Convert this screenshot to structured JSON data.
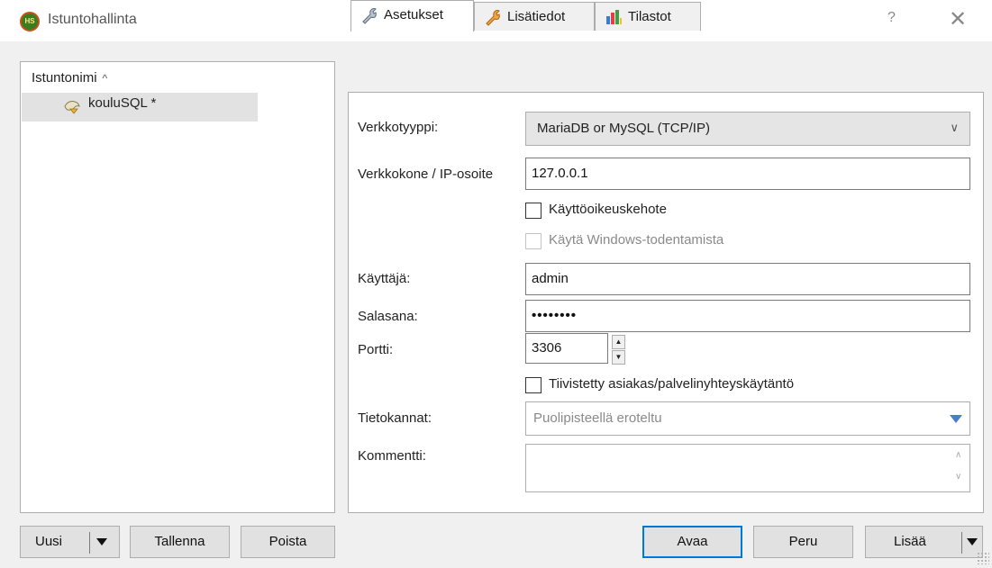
{
  "window": {
    "title": "Istuntohallinta",
    "icon_text": "HS",
    "help_label": "?",
    "close_label": "✕"
  },
  "session_list": {
    "header": "Istuntonimi",
    "sort_indicator": "^",
    "items": [
      {
        "label": "kouluSQL *",
        "icon": "dolphin-session-icon",
        "selected": true
      }
    ]
  },
  "tabs": [
    {
      "label": "Asetukset",
      "icon": "wrench-icon",
      "active": true
    },
    {
      "label": "Lisätiedot",
      "icon": "wrench-orange-icon",
      "active": false
    },
    {
      "label": "Tilastot",
      "icon": "bar-chart-icon",
      "active": false
    }
  ],
  "settings": {
    "network_type": {
      "label": "Verkkotyyppi:",
      "value": "MariaDB or MySQL (TCP/IP)"
    },
    "host": {
      "label": "Verkkokone / IP-osoite",
      "value": "127.0.0.1"
    },
    "prompt_credentials": {
      "label": "Käyttöoikeuskehote",
      "checked": false
    },
    "windows_auth": {
      "label": "Käytä Windows-todentamista",
      "checked": false,
      "disabled": true
    },
    "user": {
      "label": "Käyttäjä:",
      "value": "admin"
    },
    "password": {
      "label": "Salasana:",
      "value": "••••••••"
    },
    "port": {
      "label": "Portti:",
      "value": "3306"
    },
    "compressed": {
      "label": "Tiivistetty asiakas/palvelinyhteyskäytäntö",
      "checked": false
    },
    "databases": {
      "label": "Tietokannat:",
      "placeholder": "Puolipisteellä eroteltu"
    },
    "comment": {
      "label": "Kommentti:",
      "value": ""
    }
  },
  "buttons": {
    "new": "Uusi",
    "save": "Tallenna",
    "delete": "Poista",
    "open": "Avaa",
    "cancel": "Peru",
    "more": "Lisää"
  },
  "colors": {
    "accent": "#0078d7",
    "dropdown_arrow": "#4a7ec8",
    "selection": "#e2e2e2"
  }
}
